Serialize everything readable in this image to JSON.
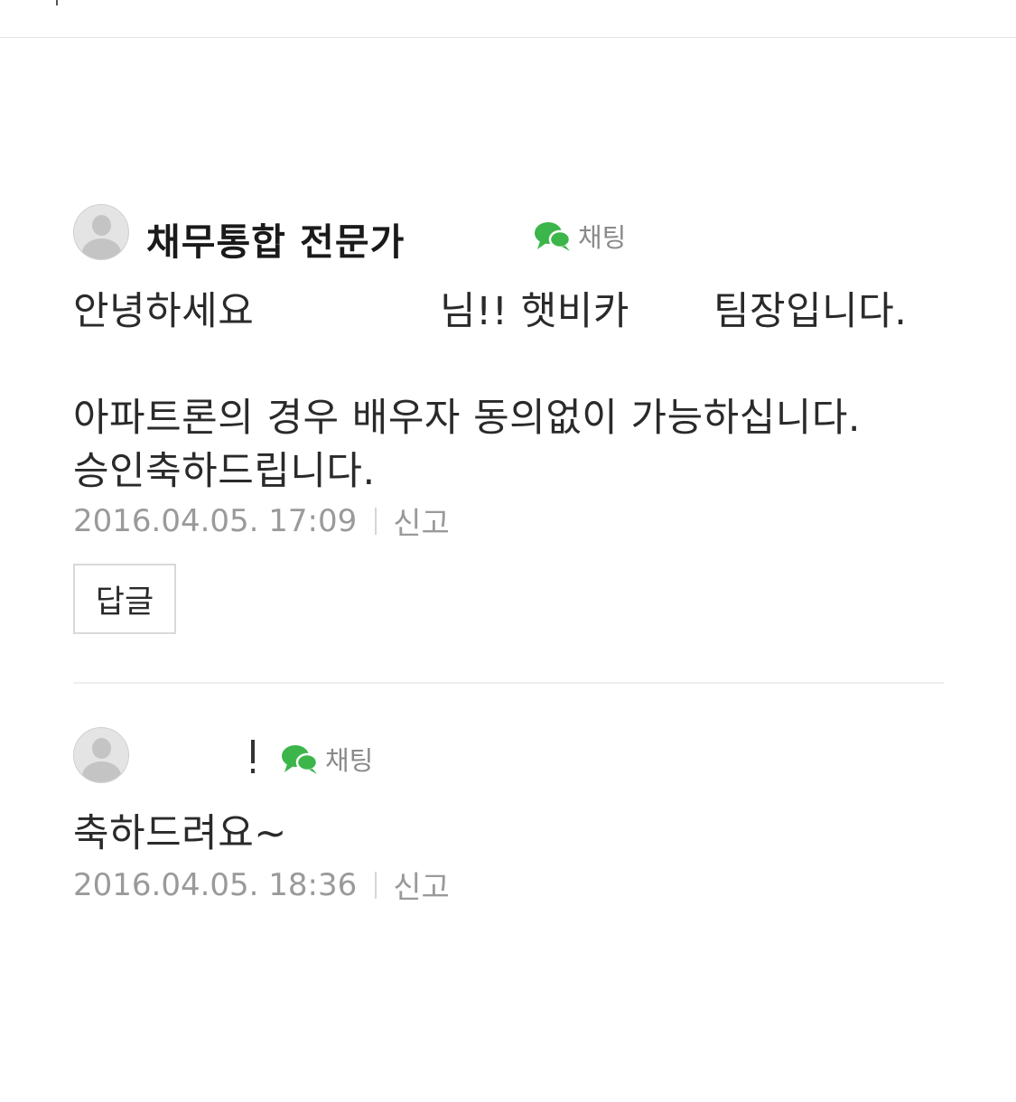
{
  "comments": [
    {
      "author": "채무통합 전문가",
      "chat_label": "채팅",
      "chat_icon": "speech-bubble-icon",
      "body": {
        "greeting": "안녕하세요",
        "honorific": "님!! 햇비카",
        "title": "팀장입니다.",
        "line2": "아파트론의 경우 배우자 동의없이 가능하십니다.",
        "line3": "승인축하드립니다."
      },
      "timestamp": "2016.04.05. 17:09",
      "report_label": "신고",
      "reply_label": "답글"
    },
    {
      "author_mark": "!",
      "chat_label": "채팅",
      "chat_icon": "speech-bubble-icon",
      "body": "축하드려요~",
      "timestamp": "2016.04.05. 18:36",
      "report_label": "신고"
    }
  ],
  "colors": {
    "chat_icon": "#3cb54a",
    "meta_text": "#9a9a9a",
    "body_text": "#2a2a2a"
  }
}
